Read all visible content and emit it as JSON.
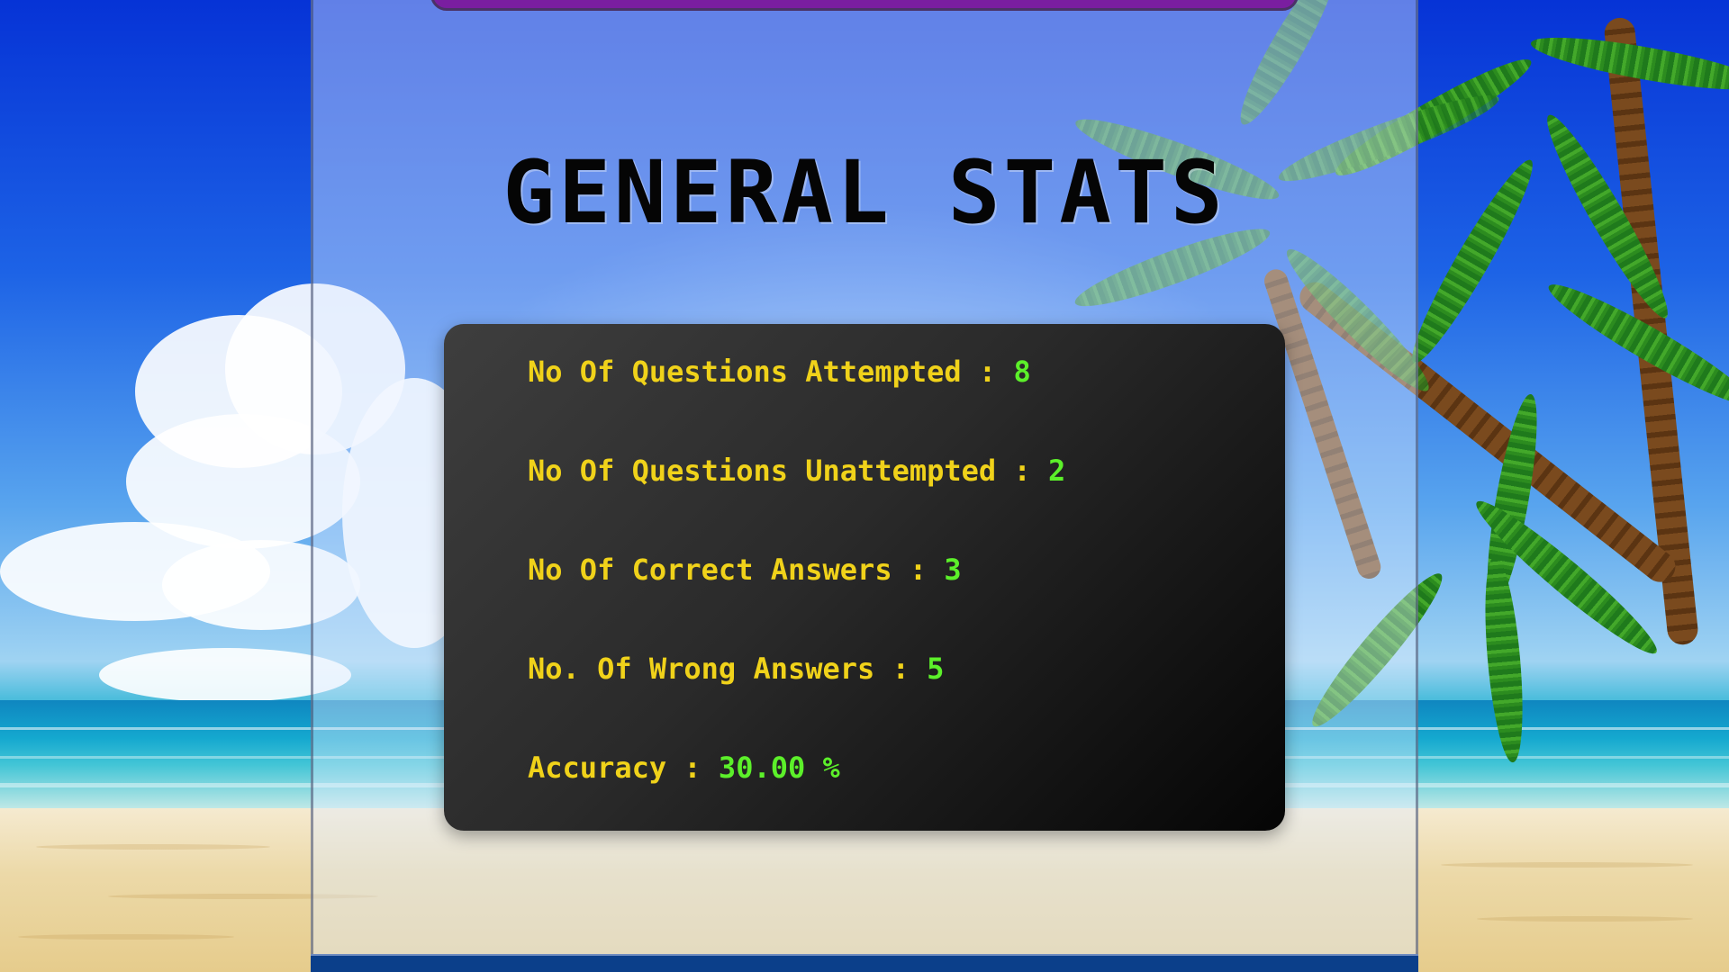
{
  "page": {
    "title": "GENERAL STATS"
  },
  "stats": [
    {
      "label": "No Of Questions Attempted",
      "separator": ":",
      "value": "8"
    },
    {
      "label": "No Of Questions Unattempted",
      "separator": ":",
      "value": "2"
    },
    {
      "label": "No Of Correct Answers",
      "separator": ":",
      "value": "3"
    },
    {
      "label": "No. Of Wrong Answers",
      "separator": ":",
      "value": "5"
    },
    {
      "label": "Accuracy",
      "separator": ":",
      "value": "30.00 %"
    }
  ],
  "colors": {
    "label": "#f0d21a",
    "value": "#5cf02a",
    "title": "#050505",
    "card": "#2a2a2a",
    "top_bar": "#7a1ea0",
    "bottom_bar": "#0b3f8a"
  }
}
